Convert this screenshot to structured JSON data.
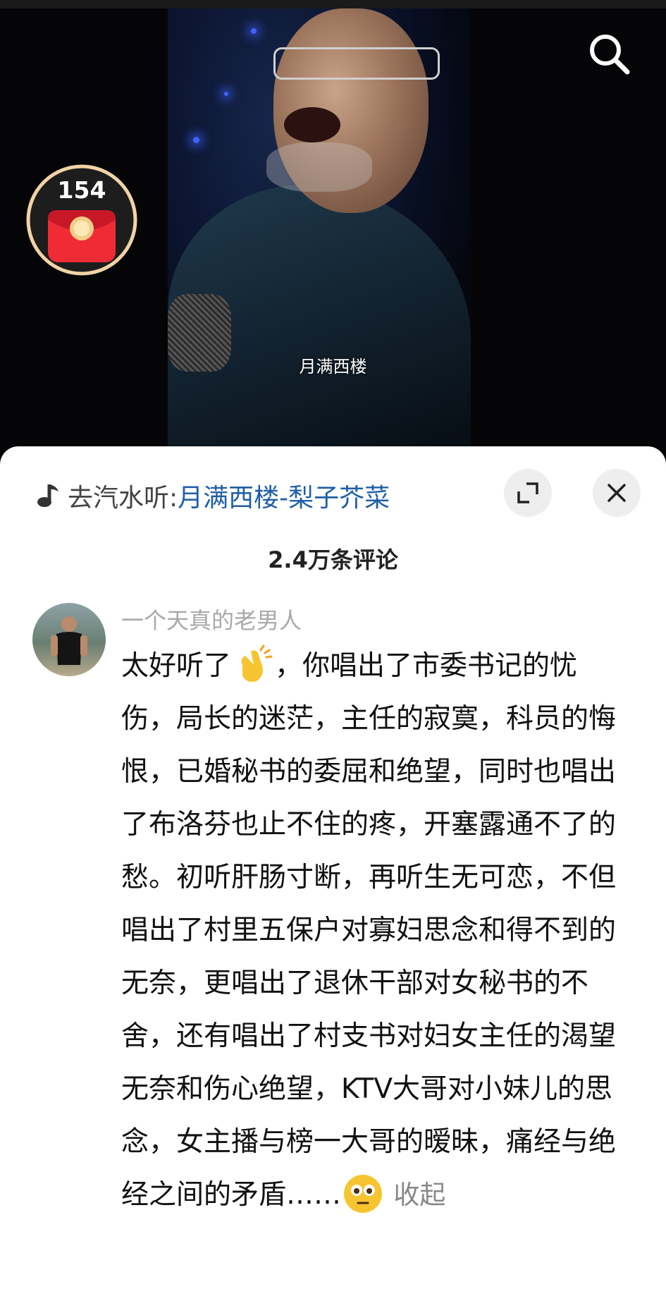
{
  "video": {
    "subtitle": "月满西楼",
    "red_packet_count": "154"
  },
  "music": {
    "prefix": "去汽水听: ",
    "title": "月满西楼-梨子芥菜"
  },
  "comments_header": {
    "count_label": "2.4万条评论"
  },
  "comment": {
    "author": "一个天真的老男人",
    "text_before_emoji": "太好听了",
    "text_after_emoji": "，你唱出了市委书记的忧伤，局长的迷茫，主任的寂寞，科员的悔恨，已婚秘书的委屈和绝望，同时也唱出了布洛芬也止不住的疼，开塞露通不了的愁。初听肝肠寸断，再听生无可恋，不但唱出了村里五保户对寡妇思念和得不到的无奈，更唱出了退休干部对女秘书的不舍，还有唱出了村支书对妇女主任的渴望无奈和伤心绝望，KTV大哥对小妹儿的思念，女主播与榜一大哥的暧昧，痛经与绝经之间的矛盾……",
    "collapse_label": "收起"
  }
}
